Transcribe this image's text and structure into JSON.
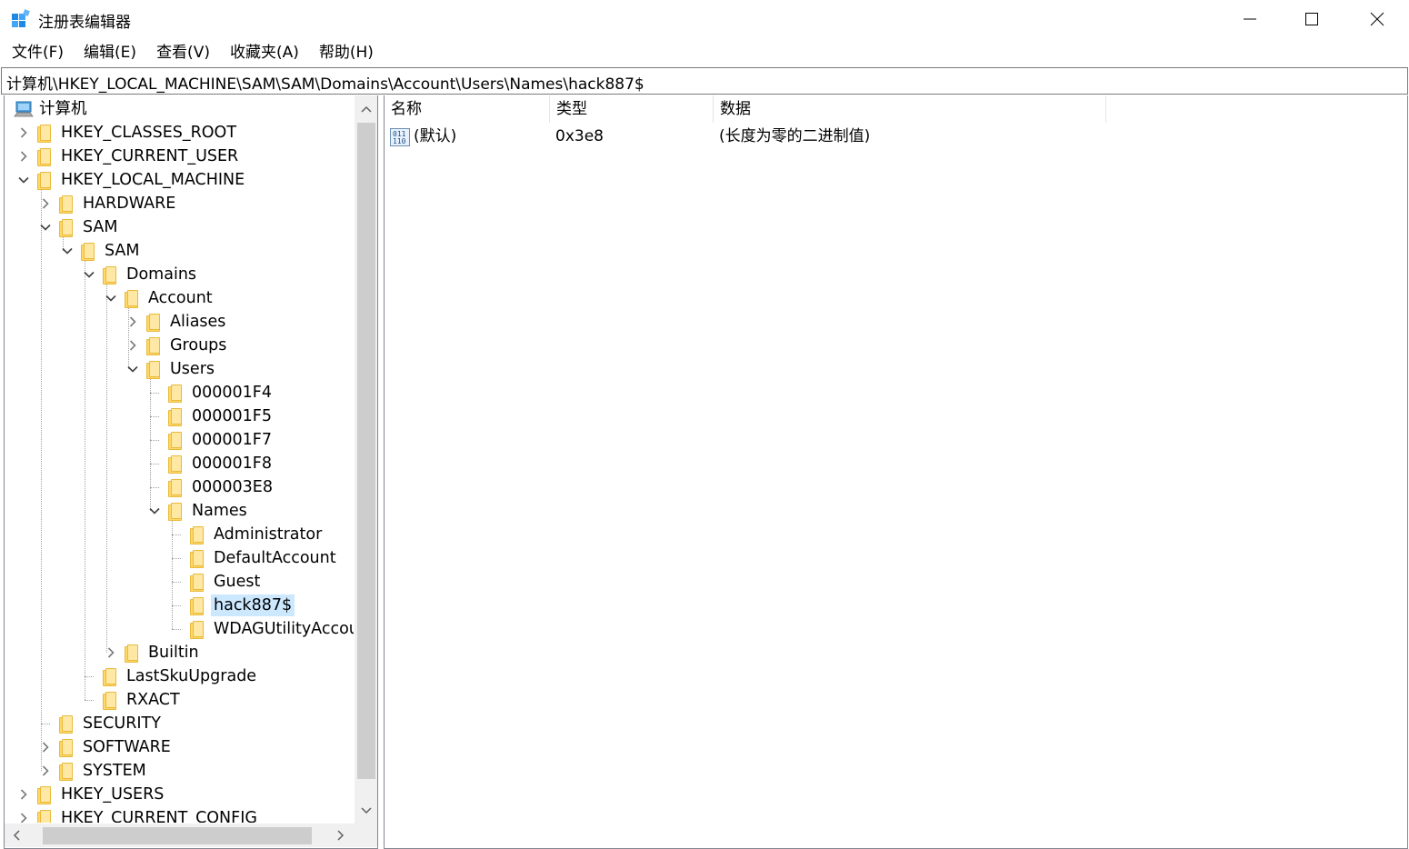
{
  "window": {
    "title": "注册表编辑器",
    "controls": {
      "minimize": "—",
      "maximize": "☐",
      "close": "✕"
    }
  },
  "menu": [
    "文件(F)",
    "编辑(E)",
    "查看(V)",
    "收藏夹(A)",
    "帮助(H)"
  ],
  "address": "计算机\\HKEY_LOCAL_MACHINE\\SAM\\SAM\\Domains\\Account\\Users\\Names\\hack887$",
  "tree": {
    "root": "计算机",
    "nodes": [
      {
        "label": "HKEY_CLASSES_ROOT",
        "level": 1,
        "state": "collapsed"
      },
      {
        "label": "HKEY_CURRENT_USER",
        "level": 1,
        "state": "collapsed"
      },
      {
        "label": "HKEY_LOCAL_MACHINE",
        "level": 1,
        "state": "expanded"
      },
      {
        "label": "HARDWARE",
        "level": 2,
        "state": "collapsed"
      },
      {
        "label": "SAM",
        "level": 2,
        "state": "expanded"
      },
      {
        "label": "SAM",
        "level": 3,
        "state": "expanded"
      },
      {
        "label": "Domains",
        "level": 4,
        "state": "expanded"
      },
      {
        "label": "Account",
        "level": 5,
        "state": "expanded"
      },
      {
        "label": "Aliases",
        "level": 6,
        "state": "collapsed"
      },
      {
        "label": "Groups",
        "level": 6,
        "state": "collapsed"
      },
      {
        "label": "Users",
        "level": 6,
        "state": "expanded"
      },
      {
        "label": "000001F4",
        "level": 7,
        "state": "leaf"
      },
      {
        "label": "000001F5",
        "level": 7,
        "state": "leaf"
      },
      {
        "label": "000001F7",
        "level": 7,
        "state": "leaf"
      },
      {
        "label": "000001F8",
        "level": 7,
        "state": "leaf"
      },
      {
        "label": "000003E8",
        "level": 7,
        "state": "leaf"
      },
      {
        "label": "Names",
        "level": 7,
        "state": "expanded"
      },
      {
        "label": "Administrator",
        "level": 8,
        "state": "leaf"
      },
      {
        "label": "DefaultAccount",
        "level": 8,
        "state": "leaf"
      },
      {
        "label": "Guest",
        "level": 8,
        "state": "leaf"
      },
      {
        "label": "hack887$",
        "level": 8,
        "state": "leaf",
        "selected": true
      },
      {
        "label": "WDAGUtilityAccou",
        "level": 8,
        "state": "leaf"
      },
      {
        "label": "Builtin",
        "level": 5,
        "state": "collapsed"
      },
      {
        "label": "LastSkuUpgrade",
        "level": 4,
        "state": "leaf"
      },
      {
        "label": "RXACT",
        "level": 4,
        "state": "leaf"
      },
      {
        "label": "SECURITY",
        "level": 2,
        "state": "leaf"
      },
      {
        "label": "SOFTWARE",
        "level": 2,
        "state": "collapsed"
      },
      {
        "label": "SYSTEM",
        "level": 2,
        "state": "collapsed"
      },
      {
        "label": "HKEY_USERS",
        "level": 1,
        "state": "collapsed"
      },
      {
        "label": "HKEY_CURRENT_CONFIG",
        "level": 1,
        "state": "collapsed"
      }
    ]
  },
  "list": {
    "columns": [
      "名称",
      "类型",
      "数据"
    ],
    "rows": [
      {
        "name": "(默认)",
        "type": "0x3e8",
        "data": "(长度为零的二进制值)"
      }
    ]
  },
  "colors": {
    "selection": "#cce8ff",
    "folder": "#ffd867",
    "scrollbar_track": "#f0f0f0",
    "scrollbar_thumb": "#cdcdcd",
    "app_icon": "#1e88e5"
  }
}
